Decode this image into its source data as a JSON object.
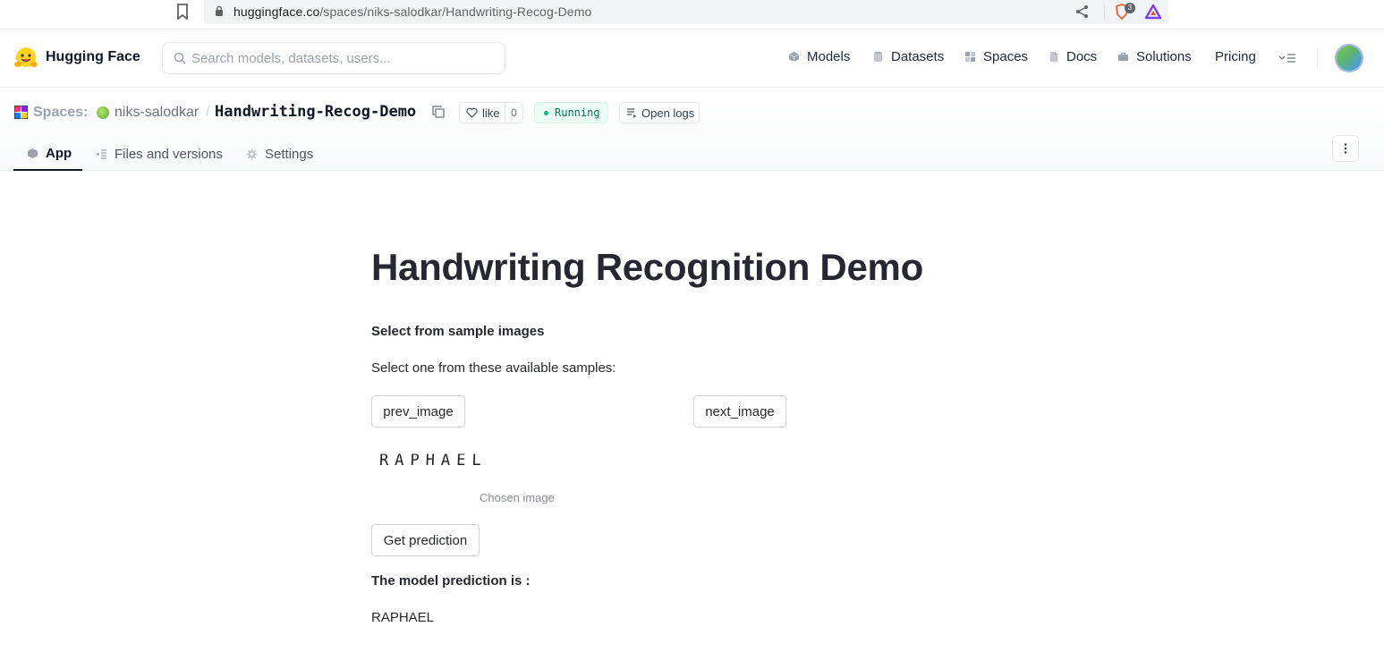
{
  "browser": {
    "url_host": "huggingface.co",
    "url_path": "/spaces/niks-salodkar/Handwriting-Recog-Demo",
    "extension_badge": "3"
  },
  "hf_nav": {
    "brand": "Hugging Face",
    "search_placeholder": "Search models, datasets, users...",
    "items": [
      {
        "label": "Models",
        "icon": "cube-icon"
      },
      {
        "label": "Datasets",
        "icon": "database-icon"
      },
      {
        "label": "Spaces",
        "icon": "grid-icon"
      },
      {
        "label": "Docs",
        "icon": "doc-icon"
      },
      {
        "label": "Solutions",
        "icon": "briefcase-icon"
      },
      {
        "label": "Pricing"
      }
    ]
  },
  "space": {
    "section": "Spaces:",
    "owner": "niks-salodkar",
    "separator": "/",
    "name": "Handwriting-Recog-Demo",
    "like_label": "like",
    "like_count": "0",
    "status": "Running",
    "logs_label": "Open logs",
    "tabs": [
      {
        "label": "App",
        "active": true
      },
      {
        "label": "Files and versions",
        "active": false
      },
      {
        "label": "Settings",
        "active": false
      }
    ]
  },
  "app": {
    "title": "Handwriting Recognition Demo",
    "select_heading": "Select from sample images",
    "select_hint": "Select one from these available samples:",
    "prev_button": "prev_image",
    "next_button": "next_image",
    "sample_word": "RAPHAEL",
    "image_caption": "Chosen image",
    "predict_button": "Get prediction",
    "prediction_label": "The model prediction is :",
    "prediction_value": "RAPHAEL"
  }
}
